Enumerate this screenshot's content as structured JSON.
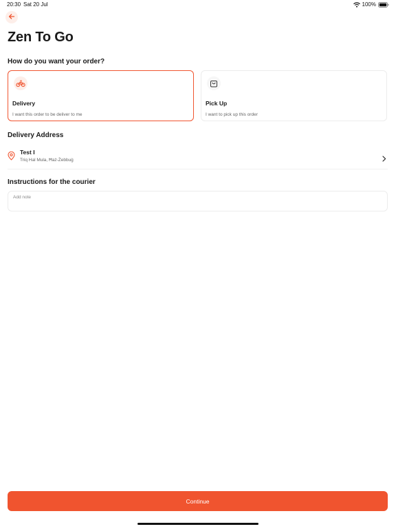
{
  "status_bar": {
    "time": "20:30",
    "date": "Sat 20 Jul",
    "battery": "100%"
  },
  "colors": {
    "accent": "#f0542f",
    "accent_light": "#fdeee9"
  },
  "header": {
    "back_icon": "arrow-left-icon",
    "title": "Zen To Go"
  },
  "order_type": {
    "question": "How do you want your order?",
    "selected": "delivery",
    "options": [
      {
        "id": "delivery",
        "icon": "bike-icon",
        "label": "Delivery",
        "description": "I want this order to be deliver to me"
      },
      {
        "id": "pickup",
        "icon": "shopping-bag-icon",
        "label": "Pick Up",
        "description": "I want to pick up this order"
      }
    ]
  },
  "delivery_address": {
    "section_title": "Delivery Address",
    "name": "Test I",
    "address": "Triq Hal Mula, Ħaż-Żebbuġ"
  },
  "instructions": {
    "section_title": "Instructions for the courier",
    "placeholder": "Add note",
    "value": ""
  },
  "footer": {
    "continue_label": "Continue"
  }
}
